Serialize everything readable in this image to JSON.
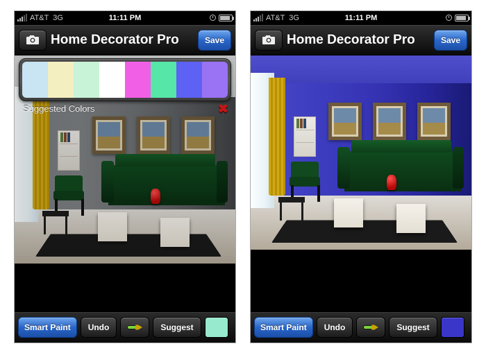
{
  "status": {
    "carrier": "AT&T",
    "network": "3G",
    "time": "11:11 PM"
  },
  "nav": {
    "title": "Home Decorator Pro",
    "save": "Save"
  },
  "palette": {
    "label": "Suggested Colors",
    "colors": [
      "#c9e4f2",
      "#f3efc0",
      "#c8f3d7",
      "#ffffff",
      "#f15fe6",
      "#56e6a8",
      "#5d61f4",
      "#9a72f4"
    ]
  },
  "toolbar": {
    "smart_paint": "Smart Paint",
    "undo": "Undo",
    "suggest": "Suggest"
  },
  "screens": [
    {
      "selected_color": "#97eacd",
      "show_palette": true,
      "wall_variant": "gray"
    },
    {
      "selected_color": "#3a36c9",
      "show_palette": false,
      "wall_variant": "blue"
    }
  ]
}
